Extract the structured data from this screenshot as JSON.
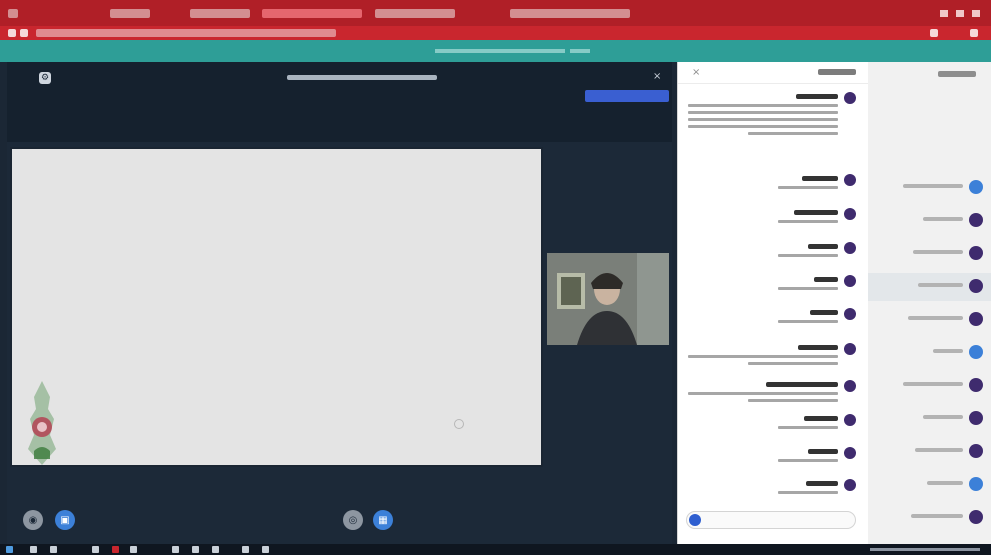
{
  "browser": {
    "tabs": [
      "",
      "",
      "",
      "",
      "",
      ""
    ],
    "active_tab_index": 3
  },
  "meeting": {
    "title": "",
    "recording_label": ""
  },
  "chat": {
    "header": "",
    "input_placeholder": "",
    "messages": [
      {
        "name": "",
        "lines": 5
      },
      {
        "name": "",
        "lines": 1
      },
      {
        "name": "",
        "lines": 1
      },
      {
        "name": "",
        "lines": 1
      },
      {
        "name": "",
        "lines": 1
      },
      {
        "name": "",
        "lines": 1
      },
      {
        "name": "",
        "lines": 2
      },
      {
        "name": "",
        "lines": 2
      },
      {
        "name": "",
        "lines": 1
      },
      {
        "name": "",
        "lines": 1
      },
      {
        "name": "",
        "lines": 1
      },
      {
        "name": "",
        "lines": 2
      }
    ]
  },
  "users": {
    "header": "",
    "items": [
      {
        "name": "",
        "avatar_color": "#3c80d8"
      },
      {
        "name": "",
        "avatar_color": "#3f2b6e"
      },
      {
        "name": "",
        "avatar_color": "#3f2b6e"
      },
      {
        "name": "",
        "avatar_color": "#3f2b6e"
      },
      {
        "name": "",
        "avatar_color": "#3f2b6e"
      },
      {
        "name": "",
        "avatar_color": "#3c80d8"
      },
      {
        "name": "",
        "avatar_color": "#3f2b6e"
      },
      {
        "name": "",
        "avatar_color": "#3f2b6e"
      },
      {
        "name": "",
        "avatar_color": "#3f2b6e"
      },
      {
        "name": "",
        "avatar_color": "#3c80d8"
      },
      {
        "name": "",
        "avatar_color": "#3f2b6e"
      },
      {
        "name": "",
        "avatar_color": "#3f2b6e"
      }
    ]
  },
  "colors": {
    "browser_chrome": "#b01f27",
    "meeting_bg": "#1c2938",
    "accent_blue": "#3c80d8",
    "teal": "#2e9e97"
  }
}
